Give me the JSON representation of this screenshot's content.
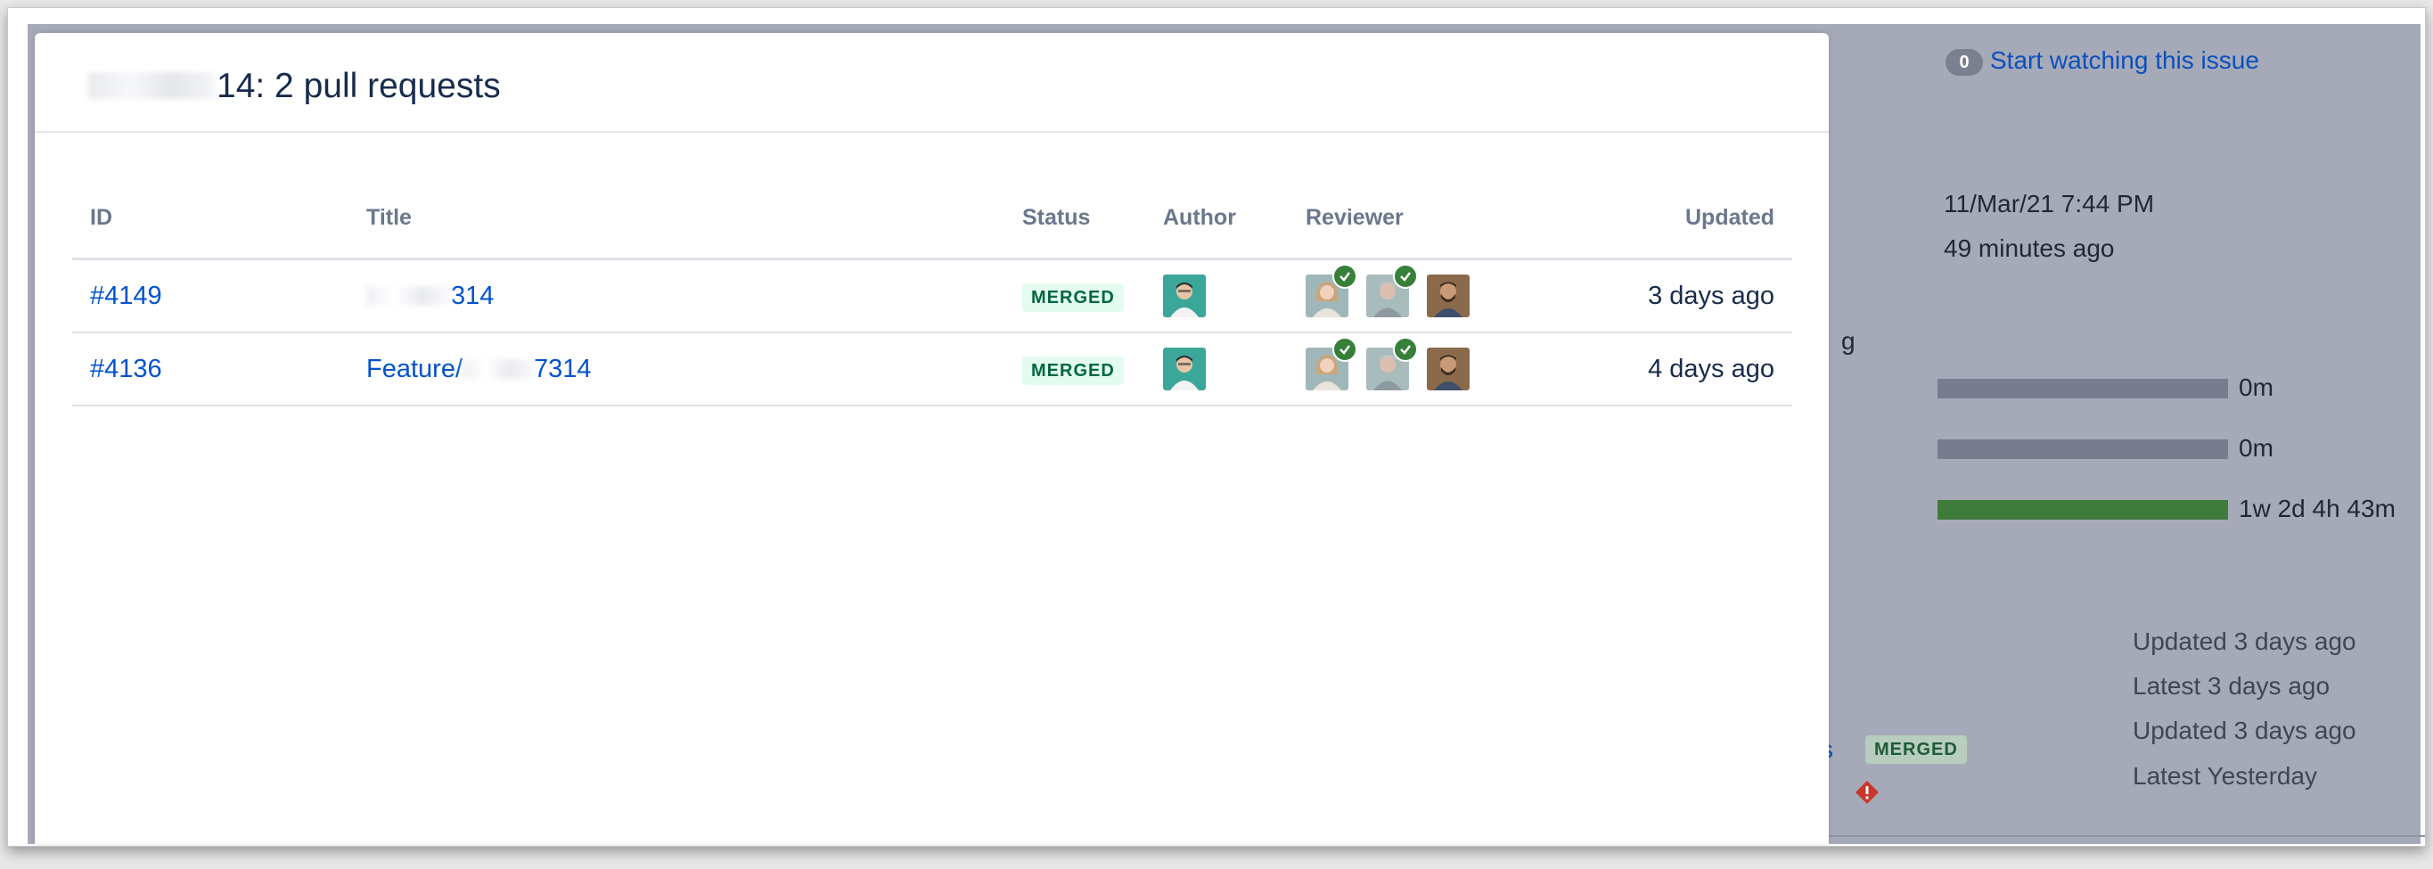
{
  "background": {
    "watch": {
      "count": "0",
      "label": "Start watching this issue"
    },
    "dates": {
      "created": "11/Mar/21 7:44 PM",
      "updated": "49 minutes ago"
    },
    "partial_heading_suffix": "g",
    "time_tracking": [
      {
        "label": "0m",
        "fraction": 0
      },
      {
        "label": "0m",
        "fraction": 0
      },
      {
        "label": "1w 2d 4h 43m",
        "fraction": 1
      }
    ],
    "dev_panel": {
      "partial_link_suffix": "s",
      "lozenge": "MERGED",
      "lines": [
        "Updated 3 days ago",
        "Latest 3 days ago",
        "Updated 3 days ago",
        "Latest Yesterday"
      ]
    },
    "colors": {
      "overlay": "#a6aab8",
      "track": "#777d8f",
      "fill": "#3f7b3a",
      "error": "#c9372c"
    }
  },
  "modal": {
    "title_suffix": "14: 2 pull requests",
    "columns": {
      "id": "ID",
      "title": "Title",
      "status": "Status",
      "author": "Author",
      "reviewer": "Reviewer",
      "updated": "Updated"
    },
    "rows": [
      {
        "id": "#4149",
        "title_visible": "314",
        "status": "MERGED",
        "author_avatar": "avatar-teal-person",
        "reviewers": [
          {
            "avatar": "avatar-woman",
            "approved": true
          },
          {
            "avatar": "avatar-older-man",
            "approved": true
          },
          {
            "avatar": "avatar-bearded-man",
            "approved": false
          }
        ],
        "updated": "3 days ago"
      },
      {
        "id": "#4136",
        "title_prefix": "Feature/",
        "title_visible": "7314",
        "status": "MERGED",
        "author_avatar": "avatar-teal-person",
        "reviewers": [
          {
            "avatar": "avatar-woman",
            "approved": true
          },
          {
            "avatar": "avatar-older-man",
            "approved": true
          },
          {
            "avatar": "avatar-bearded-man",
            "approved": false
          }
        ],
        "updated": "4 days ago"
      }
    ],
    "colors": {
      "link": "#0052cc",
      "merged_bg": "#e3fcef",
      "merged_text": "#006644",
      "approved": "#36803a"
    }
  }
}
